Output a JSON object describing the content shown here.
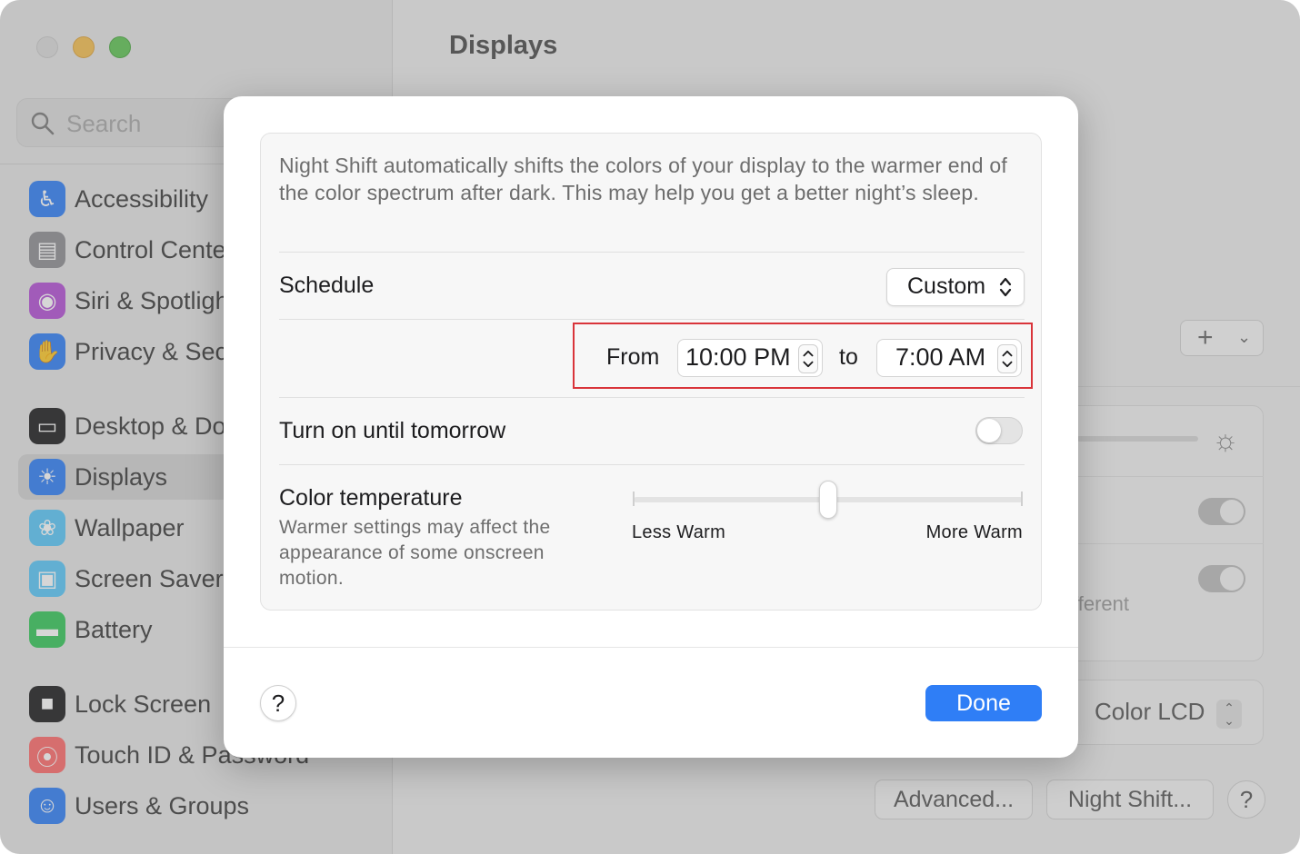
{
  "sidebar": {
    "search_placeholder": "Search",
    "items": [
      {
        "label": "Accessibility",
        "icon": "accessibility-icon",
        "color": "#2f7ef6"
      },
      {
        "label": "Control Center",
        "icon": "control-center-icon",
        "color": "#8e8e93"
      },
      {
        "label": "Siri & Spotlight",
        "icon": "siri-icon",
        "color": "#b44fd6"
      },
      {
        "label": "Privacy & Security",
        "icon": "hand-icon",
        "color": "#2f7ef6"
      },
      {
        "label": "Desktop & Dock",
        "icon": "dock-icon",
        "color": "#1c1c1e"
      },
      {
        "label": "Displays",
        "icon": "sun-icon",
        "color": "#2f7ef6",
        "selected": true
      },
      {
        "label": "Wallpaper",
        "icon": "flower-icon",
        "color": "#5ac8fa"
      },
      {
        "label": "Screen Saver",
        "icon": "screen-saver-icon",
        "color": "#5ac8fa"
      },
      {
        "label": "Battery",
        "icon": "battery-icon",
        "color": "#34c759"
      },
      {
        "label": "Lock Screen",
        "icon": "lock-icon",
        "color": "#1c1c1e"
      },
      {
        "label": "Touch ID & Password",
        "icon": "fingerprint-icon",
        "color": "#ff6b6b"
      },
      {
        "label": "Users & Groups",
        "icon": "users-icon",
        "color": "#2f7ef6"
      }
    ]
  },
  "main": {
    "title": "Displays",
    "different_fragment": "fferent",
    "color_profile": "Color LCD",
    "advanced_label": "Advanced...",
    "night_shift_label": "Night Shift...",
    "help_label": "?"
  },
  "sheet": {
    "description": "Night Shift automatically shifts the colors of your display to the warmer end of the color spectrum after dark. This may help you get a better night’s sleep.",
    "schedule_label": "Schedule",
    "schedule_value": "Custom",
    "from_label": "From",
    "from_time": "10:00 PM",
    "to_label": "to",
    "to_time": "7:00 AM",
    "until_tomorrow_label": "Turn on until tomorrow",
    "until_tomorrow_on": false,
    "temperature_title": "Color temperature",
    "temperature_subtitle": "Warmer settings may affect the appearance of some onscreen motion.",
    "temperature_min_label": "Less Warm",
    "temperature_max_label": "More Warm",
    "temperature_fraction": 0.5,
    "help_label": "?",
    "done_label": "Done",
    "accent_color": "#2f7ef6",
    "highlight_color": "#d9343a"
  }
}
